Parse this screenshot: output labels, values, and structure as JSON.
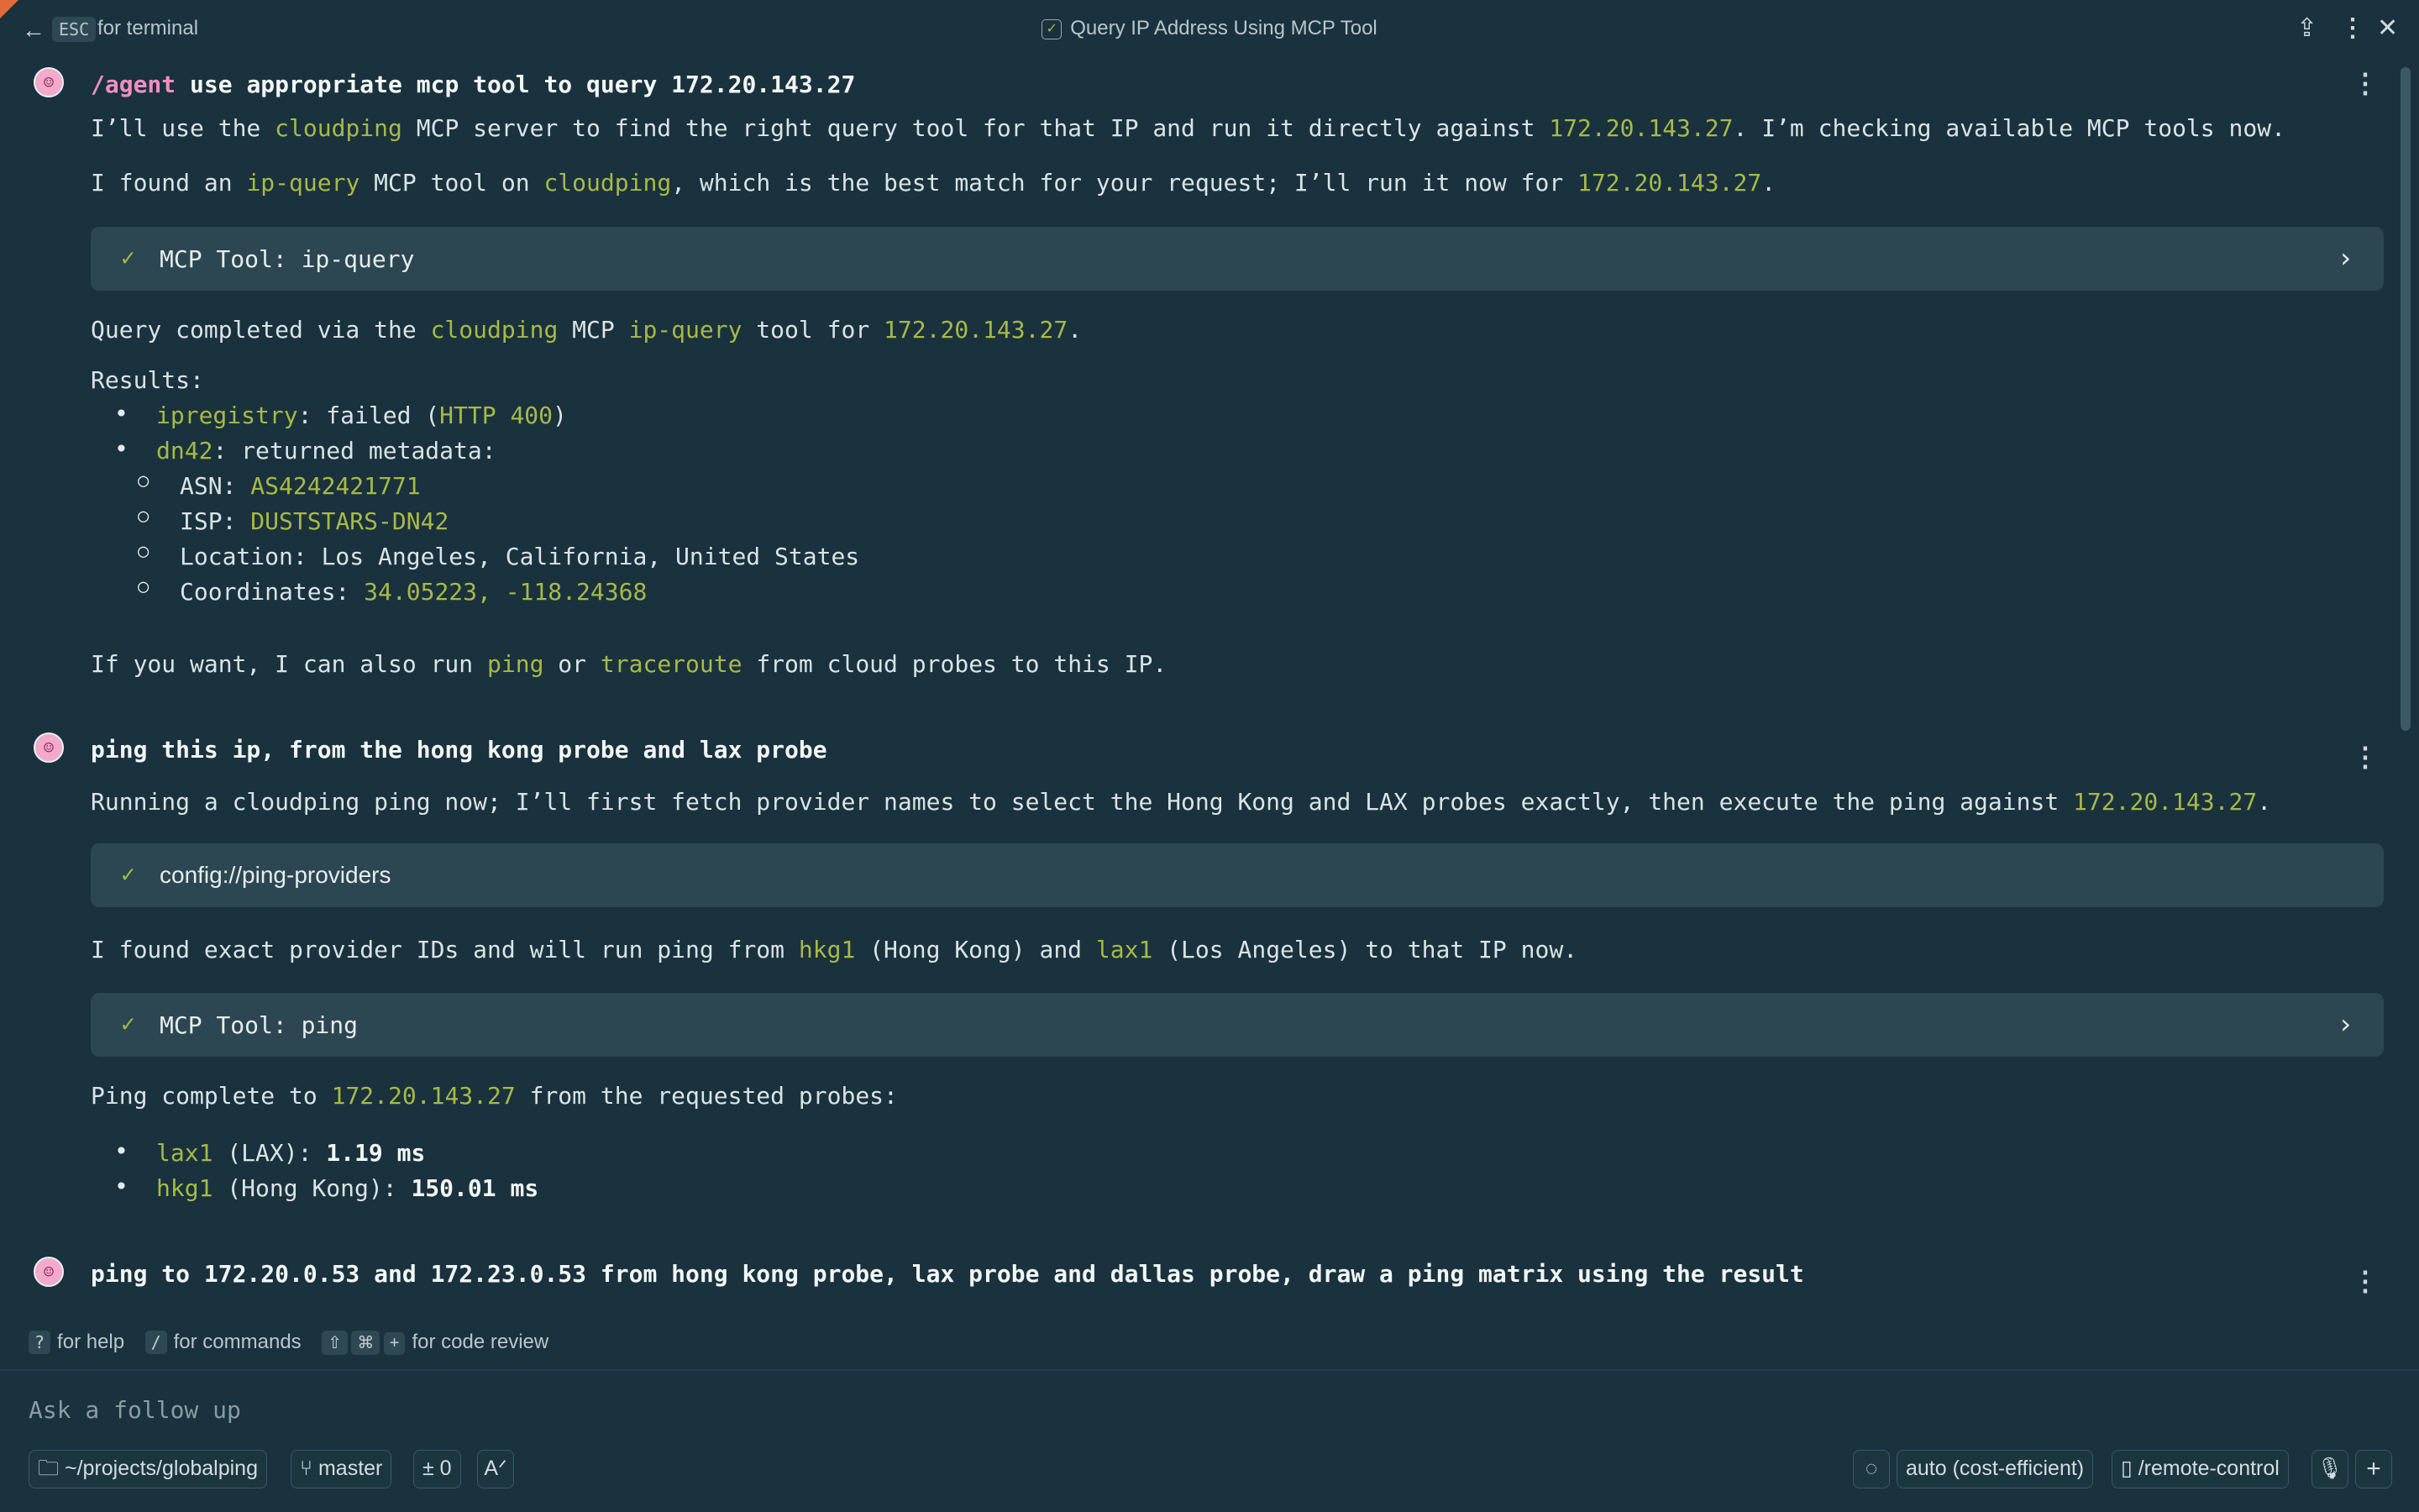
{
  "topbar": {
    "esc_key": "ESC",
    "esc_label": "for terminal",
    "title": "Query IP Address Using MCP Tool"
  },
  "messages": [
    {
      "prompt_cmd": "/agent",
      "prompt_text": " use appropriate mcp tool to query 172.20.143.27",
      "line1": [
        "I’ll use the ",
        "cloudping",
        " MCP server to find the right query tool for that IP and run it directly against ",
        "172.20.143.27",
        ". I’m checking available MCP tools now."
      ],
      "line2": [
        "I found an ",
        "ip-query",
        " MCP tool on ",
        "cloudping",
        ", which is the best match for your request; I’ll run it now for ",
        "172.20.143.27",
        "."
      ],
      "tool1": "MCP Tool: ip-query",
      "line3": [
        "Query completed via the ",
        "cloudping",
        " MCP ",
        "ip-query",
        " tool for ",
        "172.20.143.27",
        "."
      ],
      "results_label": "Results:",
      "r1": [
        "ipregistry",
        ": failed (",
        "HTTP 400",
        ")"
      ],
      "r2": [
        "dn42",
        ": returned metadata:"
      ],
      "asn": [
        "ASN: ",
        "AS4242421771"
      ],
      "isp": [
        "ISP: ",
        "DUSTSTARS-DN42"
      ],
      "location": "Location: Los Angeles, California, United States",
      "coords": [
        "Coordinates: ",
        "34.05223, -118.24368"
      ],
      "line4": [
        "If you want, I can also run ",
        "ping",
        " or ",
        "traceroute",
        " from cloud probes to this IP."
      ]
    },
    {
      "prompt_text": "ping this ip, from the hong kong probe and lax probe",
      "line1": [
        "Running a cloudping ping now; I’ll first fetch provider names to select the Hong Kong and LAX probes exactly, then execute the ping against ",
        "172.20.143.27",
        "."
      ],
      "resource": "config://ping-providers",
      "line2": [
        "I found exact provider IDs and will run ping from ",
        "hkg1",
        " (Hong Kong) and ",
        "lax1",
        " (Los Angeles) to that IP now."
      ],
      "tool": "MCP Tool: ping",
      "line3": [
        "Ping complete to ",
        "172.20.143.27",
        " from the requested probes:"
      ],
      "b1": [
        "lax1",
        " (LAX): ",
        "1.19 ms"
      ],
      "b2": [
        "hkg1",
        " (Hong Kong): ",
        "150.01 ms"
      ]
    },
    {
      "prompt_text": "ping to 172.20.0.53 and 172.23.0.53 from hong kong probe, lax probe and dallas probe, draw a ping matrix using the result"
    }
  ],
  "hints": {
    "help_key": "?",
    "help": "for help",
    "cmd_key": "/",
    "cmd": "for commands",
    "review_keys": [
      "⇧",
      "⌘",
      "+"
    ],
    "review": "for code review"
  },
  "input": {
    "placeholder": "Ask a follow up"
  },
  "status": {
    "folder": "~/projects/globalping",
    "branch": "master",
    "diff": "± 0",
    "model": "auto (cost-efficient)",
    "remote": "/remote-control"
  }
}
